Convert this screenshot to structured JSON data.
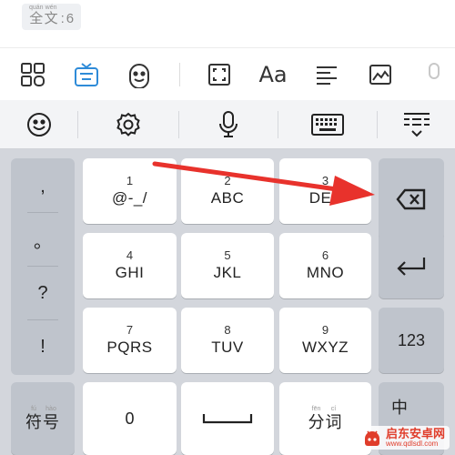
{
  "editor": {
    "count_ruby": [
      {
        "pinyin": "quán",
        "hanzi": "全"
      },
      {
        "pinyin": "wén",
        "hanzi": "文"
      }
    ],
    "count_sep": ":",
    "count_value": "6"
  },
  "toolbar": {
    "font_button_label": "Aa",
    "icons": [
      "apps-icon",
      "keyboard-icon",
      "emoji-face-icon",
      "fullscreen-icon",
      "font-icon",
      "align-left-icon",
      "image-icon",
      "microphone-icon"
    ]
  },
  "keyboard": {
    "func_row_icons": [
      "smiley-icon",
      "gear-icon",
      "microphone-icon",
      "keyboard-icon",
      "collapse-keyboard-icon"
    ],
    "punctuation": [
      ",",
      "。",
      "?",
      "!"
    ],
    "keys": [
      {
        "num": "1",
        "letters": "@-_/"
      },
      {
        "num": "2",
        "letters": "ABC"
      },
      {
        "num": "3",
        "letters": "DEF"
      },
      {
        "num": "4",
        "letters": "GHI"
      },
      {
        "num": "5",
        "letters": "JKL"
      },
      {
        "num": "6",
        "letters": "MNO"
      },
      {
        "num": "7",
        "letters": "PQRS"
      },
      {
        "num": "8",
        "letters": "TUV"
      },
      {
        "num": "9",
        "letters": "WXYZ"
      }
    ],
    "symbol_ruby": [
      {
        "pinyin": "fú",
        "hanzi": "符"
      },
      {
        "pinyin": "hào",
        "hanzi": "号"
      }
    ],
    "zero_label": "0",
    "fenci_ruby": [
      {
        "pinyin": "fēn",
        "hanzi": "分"
      },
      {
        "pinyin": "cí",
        "hanzi": "词"
      }
    ],
    "num_switch_label": "123",
    "lang_switch_label": "中"
  },
  "annotation": {
    "arrow_color": "#e8322c"
  },
  "watermark": {
    "title": "启东安卓网",
    "url": "www.qdlsdl.com"
  }
}
